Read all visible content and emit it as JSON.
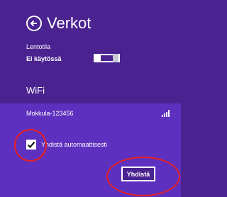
{
  "header": {
    "title": "Verkot",
    "back_icon": "back-arrow-icon"
  },
  "airplane_mode": {
    "label": "Lentotila",
    "state": "Ei käytössä",
    "enabled": false
  },
  "wifi": {
    "heading": "WiFi",
    "network": {
      "name": "Mokkula-123456",
      "signal_icon": "signal-strength-icon",
      "auto_connect_label": "Yhdistä automaattisesti",
      "auto_connect_checked": true,
      "connect_label": "Yhdistä"
    }
  },
  "colors": {
    "background": "#4a2390",
    "panel": "#5e30bf",
    "annotation": "#e8201f"
  }
}
